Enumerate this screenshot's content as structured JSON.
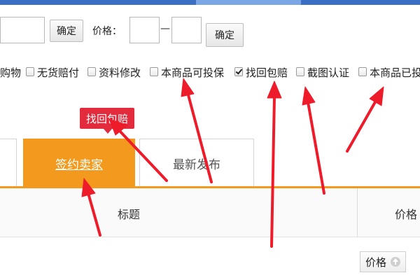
{
  "filter": {
    "confirm_label": "确定",
    "price_label": "价格：",
    "price_dash": "—",
    "price_confirm_label": "确定"
  },
  "checkboxes": [
    {
      "label": "购物",
      "checked": false,
      "partial": true
    },
    {
      "label": "无货赔付",
      "checked": false
    },
    {
      "label": "资料修改",
      "checked": false
    },
    {
      "label": "本商品可投保",
      "checked": false
    },
    {
      "label": "找回包赔",
      "checked": true
    },
    {
      "label": "截图认证",
      "checked": false
    },
    {
      "label": "本商品已投",
      "checked": false
    }
  ],
  "tooltip": {
    "text": "找回包赔"
  },
  "tabs": [
    {
      "label": "签约卖家",
      "active": true
    },
    {
      "label": "最新发布",
      "active": false
    }
  ],
  "table": {
    "headers": [
      "标题",
      "价格"
    ]
  },
  "sort": {
    "label": "价格",
    "icon": "arrow-up-icon"
  },
  "colors": {
    "accent": "#f39a1e",
    "tooltip": "#e22b3c",
    "arrow": "#ee1c2a"
  }
}
